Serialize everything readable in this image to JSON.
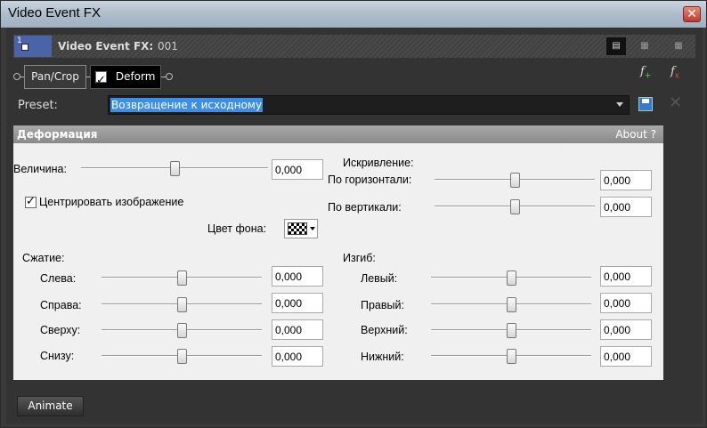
{
  "window": {
    "title": "Video Event FX",
    "close": "✕"
  },
  "header": {
    "title": "Video Event FX:",
    "event_number": "001",
    "thumb_number": "1"
  },
  "chain": {
    "pan_crop": "Pan/Crop",
    "deform": "Deform",
    "deform_checked": true
  },
  "preset": {
    "label": "Preset:",
    "value": "Возвращение к исходному"
  },
  "panel": {
    "title": "Деформация",
    "about": "About ?",
    "amount": {
      "label": "Величина:",
      "value": "0,000",
      "level": 0.5
    },
    "center_image": {
      "label": "Центрировать изображение",
      "checked": true
    },
    "bg_color": {
      "label": "Цвет фона:"
    },
    "skew": {
      "title": "Искривление:",
      "horizontal": {
        "label": "По горизонтали:",
        "value": "0,000",
        "level": 0.5
      },
      "vertical": {
        "label": "По вертикали:",
        "value": "0,000",
        "level": 0.5
      }
    },
    "squeeze": {
      "title": "Сжатие:",
      "left": {
        "label": "Слева:",
        "value": "0,000",
        "level": 0.5
      },
      "right": {
        "label": "Справа:",
        "value": "0,000",
        "level": 0.5
      },
      "top": {
        "label": "Сверху:",
        "value": "0,000",
        "level": 0.5
      },
      "bottom": {
        "label": "Снизу:",
        "value": "0,000",
        "level": 0.5
      }
    },
    "bend": {
      "title": "Изгиб:",
      "left": {
        "label": "Левый:",
        "value": "0,000",
        "level": 0.5
      },
      "right": {
        "label": "Правый:",
        "value": "0,000",
        "level": 0.5
      },
      "top": {
        "label": "Верхний:",
        "value": "0,000",
        "level": 0.5
      },
      "bottom": {
        "label": "Нижний:",
        "value": "0,000",
        "level": 0.5
      }
    }
  },
  "footer": {
    "animate": "Animate"
  }
}
